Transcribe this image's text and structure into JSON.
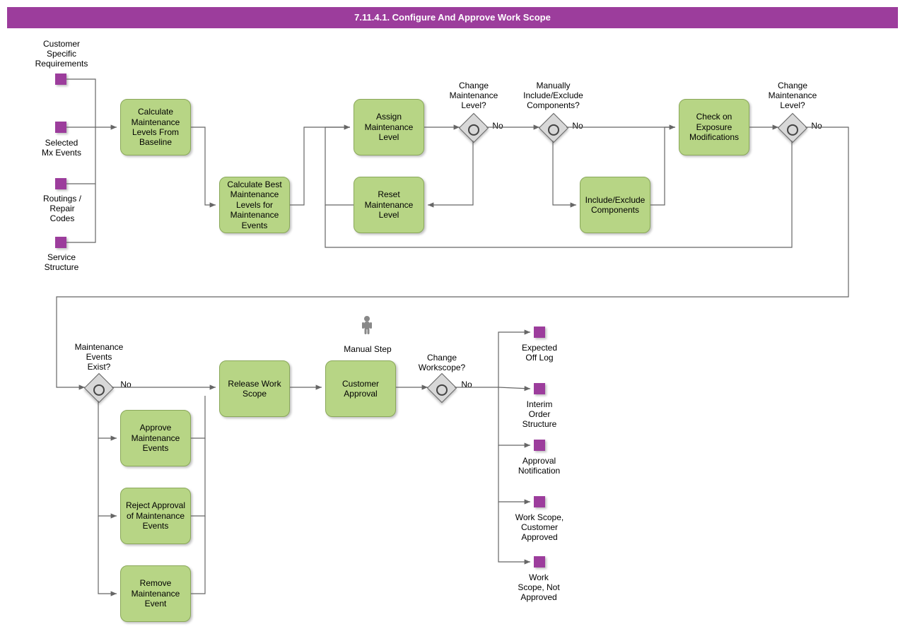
{
  "title": "7.11.4.1. Configure And Approve Work Scope",
  "inputs": {
    "csr": "Customer\nSpecific\nRequirements",
    "selmx": "Selected\nMx Events",
    "routing": "Routings /\nRepair\nCodes",
    "svc": "Service\nStructure"
  },
  "tasks": {
    "calcBaseline": "Calculate\nMaintenance\nLevels From\nBaseline",
    "calcBest": "Calculate Best\nMaintenance\nLevels for\nMaintenance\nEvents",
    "assign": "Assign\nMaintenance\nLevel",
    "reset": "Reset\nMaintenance\nLevel",
    "inclExcl": "Include/Exclude\nComponents",
    "checkExp": "Check on\nExposure\nModifications",
    "approveMx": "Approve\nMaintenance\nEvents",
    "rejectMx": "Reject Approval\nof Maintenance\nEvents",
    "removeMx": "Remove\nMaintenance\nEvent",
    "release": "Release Work\nScope",
    "custAppr": "Customer\nApproval"
  },
  "gatewayLabels": {
    "chgMaint1": "Change\nMaintenance\nLevel?",
    "manIncl": "Manually\nInclude/Exclude\nComponents?",
    "chgMaint2": "Change\nMaintenance\nLevel?",
    "mxExist": "Maintenance\nEvents\nExist?",
    "chgWork": "Change\nWorkscope?"
  },
  "edgeLabels": {
    "no": "No"
  },
  "manualStep": "Manual Step",
  "outputs": {
    "expOff": "Expected\nOff Log",
    "interim": "Interim\nOrder\nStructure",
    "apprNotif": "Approval\nNotification",
    "wsCustAppr": "Work Scope,\nCustomer\nApproved",
    "wsNotAppr": "Work\nScope, Not\nApproved"
  }
}
